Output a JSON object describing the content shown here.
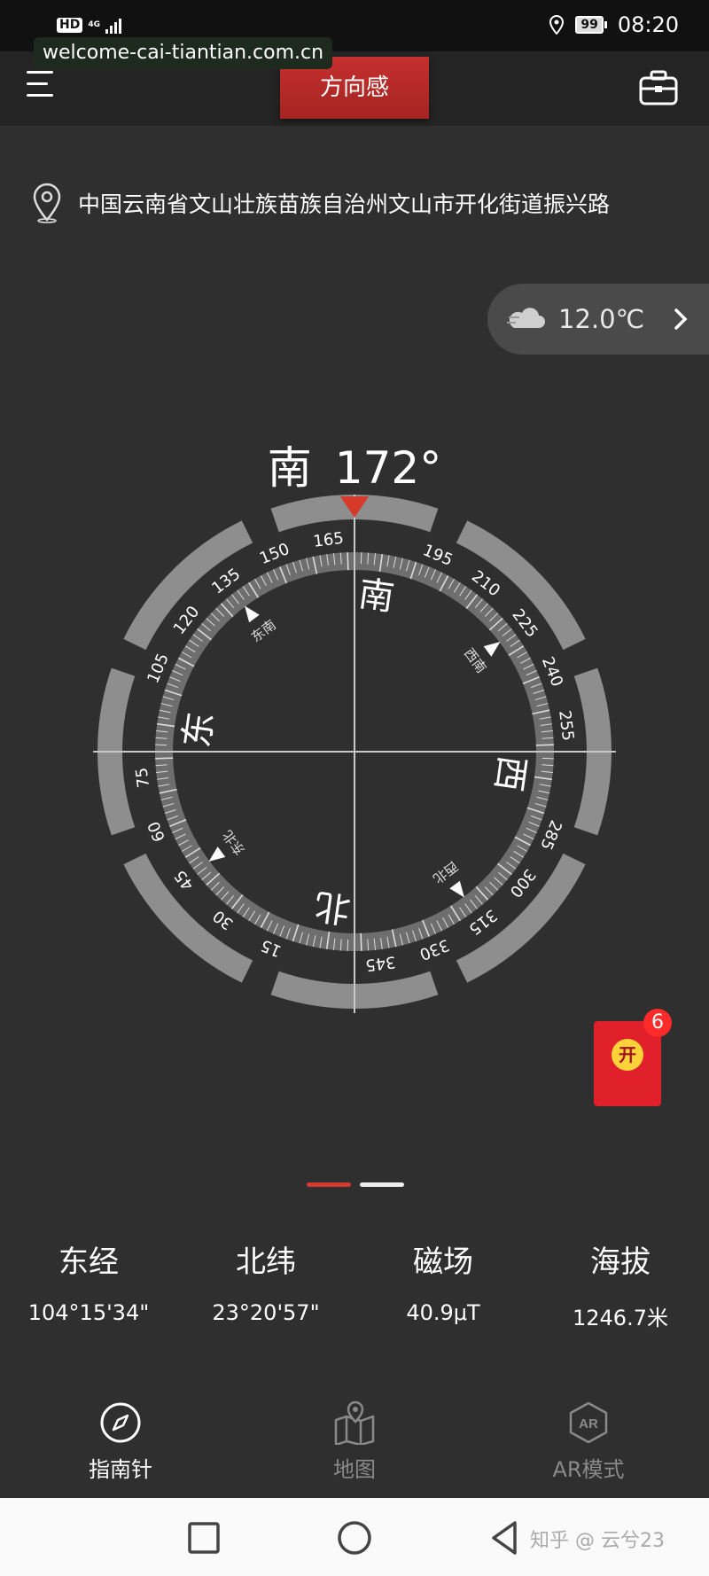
{
  "status_bar": {
    "hd_badge": "HD",
    "network": "4G",
    "battery": "99",
    "time": "08:20"
  },
  "watermark": "welcome-cai-tiantian.com.cn",
  "header": {
    "title": "方向感",
    "menu_icon": "hamburger-menu-icon",
    "toolbox_icon": "toolbox-icon"
  },
  "location": {
    "address": "中国云南省文山壮族苗族自治州文山市开化街道振兴路"
  },
  "weather": {
    "icon": "cloud-icon",
    "temperature": "12.0℃"
  },
  "heading": {
    "direction": "南",
    "degrees": "172°"
  },
  "compass": {
    "heading_deg": 172,
    "cardinals": [
      "南",
      "西",
      "北",
      "东"
    ],
    "intercardinals": [
      "西南",
      "西北",
      "东北",
      "东南"
    ],
    "degree_labels": [
      "195",
      "210",
      "225",
      "240",
      "255",
      "285",
      "300",
      "315",
      "330",
      "345",
      "15",
      "30",
      "45",
      "60",
      "75",
      "105",
      "120",
      "135",
      "150",
      "165"
    ],
    "accent_color": "#d63a2a"
  },
  "red_packet": {
    "label": "开",
    "badge_count": "6",
    "color": "#e0202a"
  },
  "stats": [
    {
      "label": "东经",
      "value": "104°15'34\""
    },
    {
      "label": "北纬",
      "value": "23°20'57\""
    },
    {
      "label": "磁场",
      "value": "40.9μT"
    },
    {
      "label": "海拔",
      "value": "1246.7米"
    }
  ],
  "tabs": [
    {
      "label": "指南针",
      "icon": "compass-icon",
      "active": true
    },
    {
      "label": "地图",
      "icon": "map-icon",
      "active": false
    },
    {
      "label": "AR模式",
      "icon": "ar-icon",
      "active": false
    }
  ],
  "nav_bar": {
    "watermark_text": "知乎 @ 云兮23"
  }
}
